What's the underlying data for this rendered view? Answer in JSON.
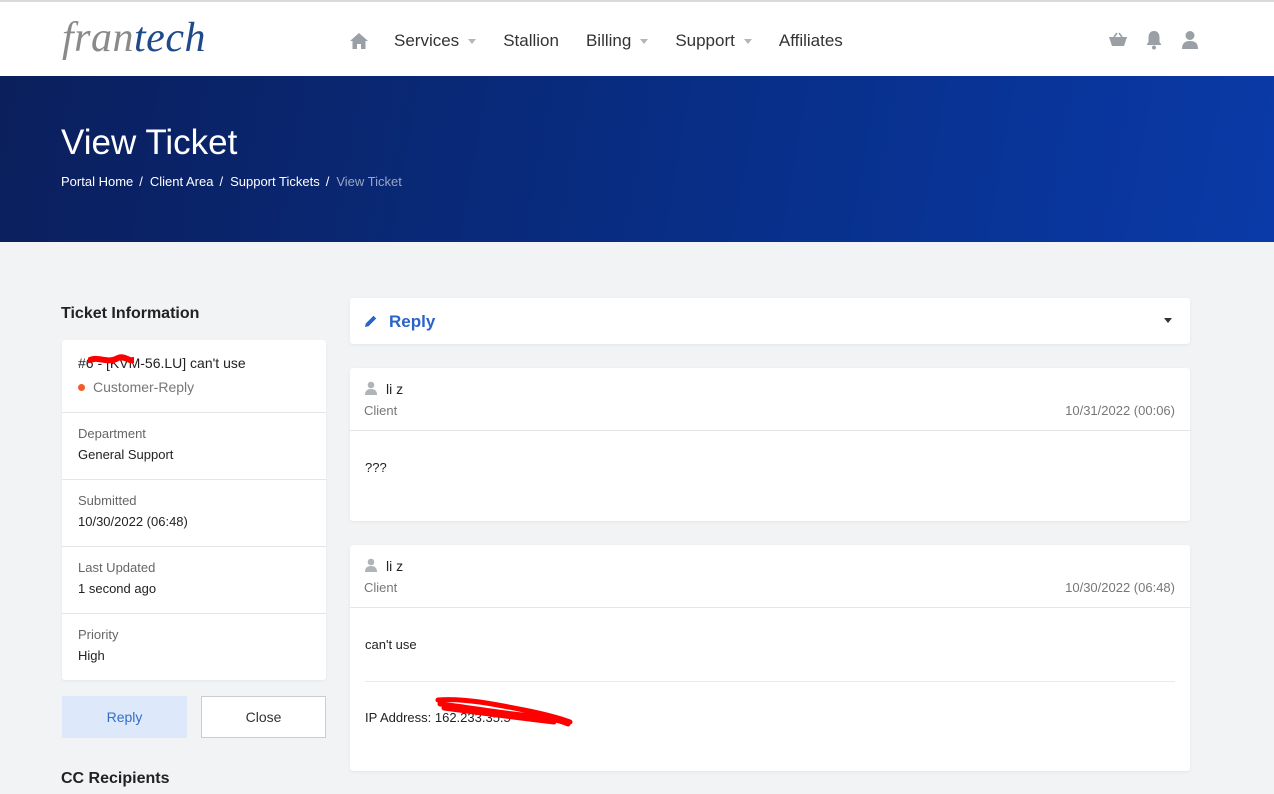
{
  "brand": {
    "part1": "fran",
    "part2": "tech"
  },
  "nav": {
    "items": [
      {
        "label": "Services",
        "dropdown": true
      },
      {
        "label": "Stallion",
        "dropdown": false
      },
      {
        "label": "Billing",
        "dropdown": true
      },
      {
        "label": "Support",
        "dropdown": true
      },
      {
        "label": "Affiliates",
        "dropdown": false
      }
    ],
    "right_icons": [
      "cart-icon",
      "bell-icon",
      "user-icon"
    ]
  },
  "hero": {
    "title": "View Ticket",
    "breadcrumbs": [
      "Portal Home",
      "Client Area",
      "Support Tickets",
      "View Ticket"
    ]
  },
  "sidebar": {
    "title": "Ticket Information",
    "ticket_subject": "#6    - [KVM-56.LU] can't use",
    "status": "Customer-Reply",
    "status_color": "#f25c29",
    "fields": [
      {
        "label": "Department",
        "value": "General Support"
      },
      {
        "label": "Submitted",
        "value": "10/30/2022 (06:48)"
      },
      {
        "label": "Last Updated",
        "value": "1 second ago"
      },
      {
        "label": "Priority",
        "value": "High"
      }
    ],
    "reply_label": "Reply",
    "close_label": "Close",
    "cc_title": "CC Recipients"
  },
  "main": {
    "reply_label": "Reply",
    "messages": [
      {
        "author": "li z",
        "role": "Client",
        "date": "10/31/2022 (00:06)",
        "body": "???",
        "ip": ""
      },
      {
        "author": "li z",
        "role": "Client",
        "date": "10/30/2022 (06:48)",
        "body": "can't use",
        "ip": "IP Address: 162.233.35.5"
      }
    ]
  },
  "colors": {
    "hero_start": "#0b1f5c",
    "hero_end": "#0a3aa8",
    "accent": "#2a63c9",
    "redaction": "#ff0000"
  }
}
